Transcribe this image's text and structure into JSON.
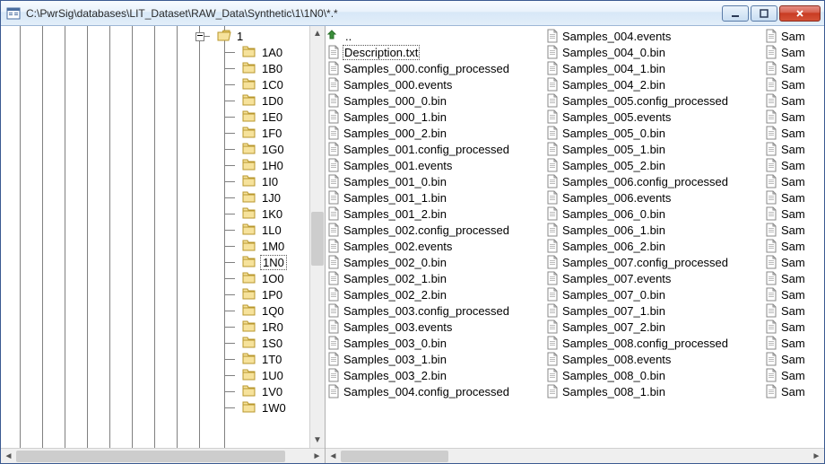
{
  "window": {
    "title": "C:\\PwrSig\\databases\\LIT_Dataset\\RAW_Data\\Synthetic\\1\\1N0\\*.*"
  },
  "tree": {
    "parent_label": "1",
    "selected": "1N0",
    "items": [
      "1A0",
      "1B0",
      "1C0",
      "1D0",
      "1E0",
      "1F0",
      "1G0",
      "1H0",
      "1I0",
      "1J0",
      "1K0",
      "1L0",
      "1M0",
      "1N0",
      "1O0",
      "1P0",
      "1Q0",
      "1R0",
      "1S0",
      "1T0",
      "1U0",
      "1V0",
      "1W0"
    ]
  },
  "files": {
    "updir": "..",
    "selected": "Description.txt",
    "col0": [
      "Description.txt",
      "Samples_000.config_processed",
      "Samples_000.events",
      "Samples_000_0.bin",
      "Samples_000_1.bin",
      "Samples_000_2.bin",
      "Samples_001.config_processed",
      "Samples_001.events",
      "Samples_001_0.bin",
      "Samples_001_1.bin",
      "Samples_001_2.bin",
      "Samples_002.config_processed",
      "Samples_002.events",
      "Samples_002_0.bin",
      "Samples_002_1.bin",
      "Samples_002_2.bin",
      "Samples_003.config_processed",
      "Samples_003.events",
      "Samples_003_0.bin",
      "Samples_003_1.bin",
      "Samples_003_2.bin",
      "Samples_004.config_processed"
    ],
    "col1": [
      "Samples_004.events",
      "Samples_004_0.bin",
      "Samples_004_1.bin",
      "Samples_004_2.bin",
      "Samples_005.config_processed",
      "Samples_005.events",
      "Samples_005_0.bin",
      "Samples_005_1.bin",
      "Samples_005_2.bin",
      "Samples_006.config_processed",
      "Samples_006.events",
      "Samples_006_0.bin",
      "Samples_006_1.bin",
      "Samples_006_2.bin",
      "Samples_007.config_processed",
      "Samples_007.events",
      "Samples_007_0.bin",
      "Samples_007_1.bin",
      "Samples_007_2.bin",
      "Samples_008.config_processed",
      "Samples_008.events",
      "Samples_008_0.bin",
      "Samples_008_1.bin"
    ],
    "col2": [
      "Sam",
      "Sam",
      "Sam",
      "Sam",
      "Sam",
      "Sam",
      "Sam",
      "Sam",
      "Sam",
      "Sam",
      "Sam",
      "Sam",
      "Sam",
      "Sam",
      "Sam",
      "Sam",
      "Sam",
      "Sam",
      "Sam",
      "Sam",
      "Sam",
      "Sam",
      "Sam"
    ]
  }
}
